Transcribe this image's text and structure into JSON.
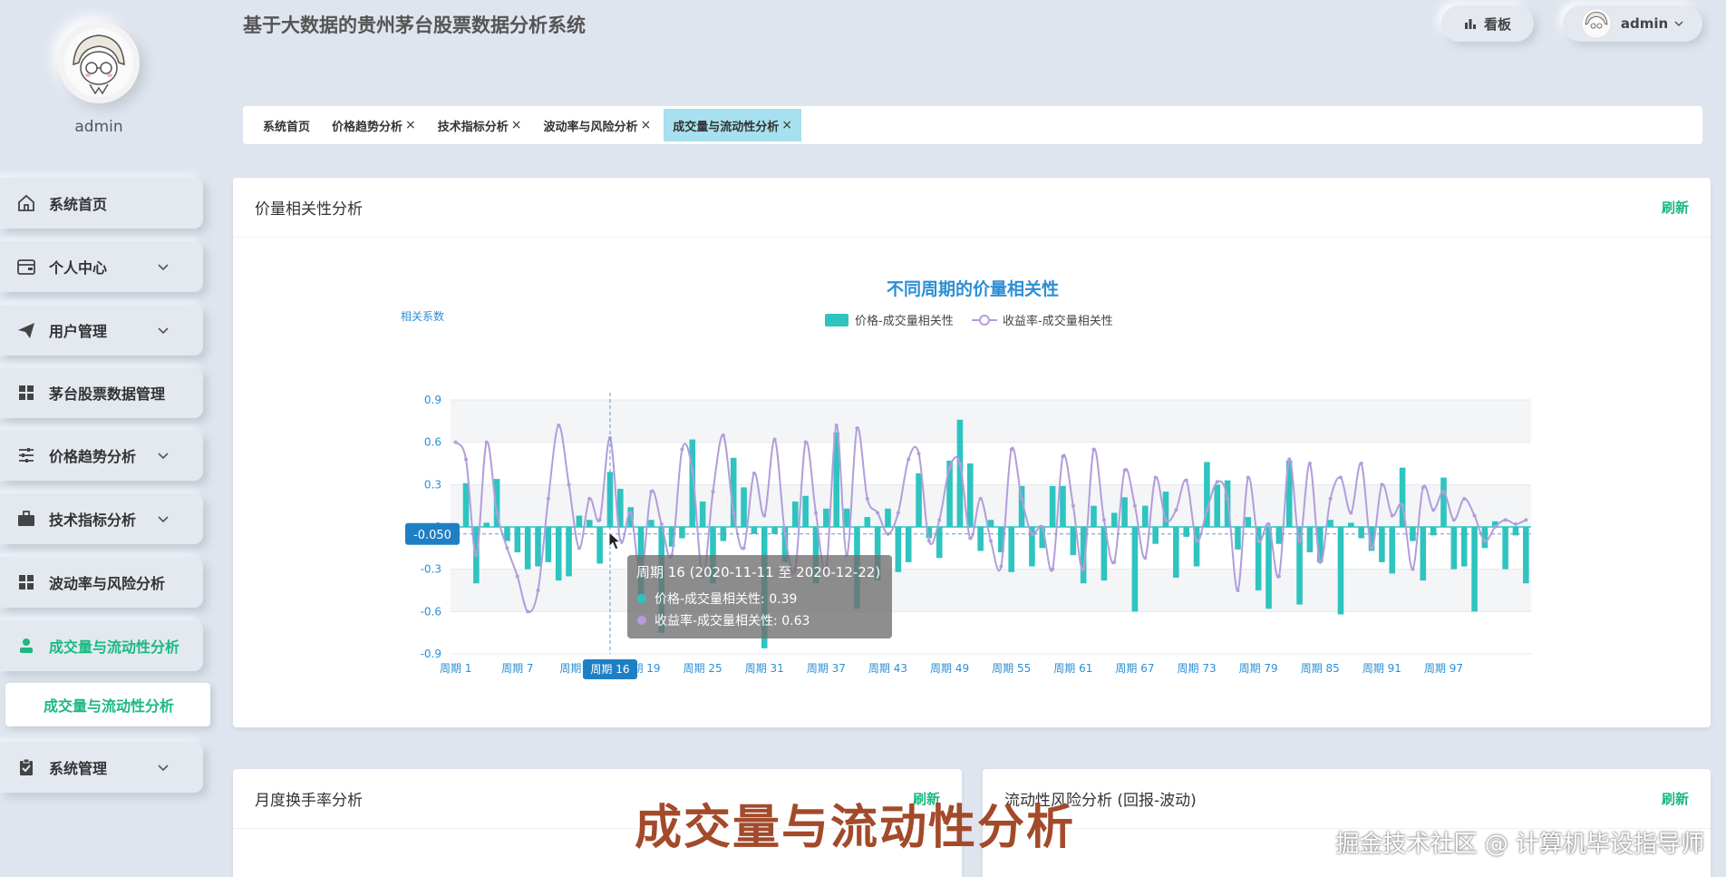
{
  "app": {
    "title": "基于大数据的贵州茅台股票数据分析系统"
  },
  "sidebar": {
    "username": "admin",
    "items": [
      {
        "label": "系统首页",
        "icon": "home-icon",
        "expandable": false
      },
      {
        "label": "个人中心",
        "icon": "wallet-icon",
        "expandable": true
      },
      {
        "label": "用户管理",
        "icon": "send-icon",
        "expandable": true
      },
      {
        "label": "茅台股票数据管理",
        "icon": "grid-icon",
        "expandable": false
      },
      {
        "label": "价格趋势分析",
        "icon": "sliders-icon",
        "expandable": true
      },
      {
        "label": "技术指标分析",
        "icon": "briefcase-icon",
        "expandable": true
      },
      {
        "label": "波动率与风险分析",
        "icon": "grid-icon",
        "expandable": false
      },
      {
        "label": "成交量与流动性分析",
        "icon": "user-icon",
        "expandable": false,
        "active": true
      },
      {
        "label": "系统管理",
        "icon": "clipboard-icon",
        "expandable": true
      }
    ],
    "sub_item": "成交量与流动性分析"
  },
  "topbar": {
    "board_label": "看板",
    "user_label": "admin"
  },
  "tabs": [
    {
      "label": "系统首页",
      "closable": false
    },
    {
      "label": "价格趋势分析",
      "closable": true
    },
    {
      "label": "技术指标分析",
      "closable": true
    },
    {
      "label": "波动率与风险分析",
      "closable": true
    },
    {
      "label": "成交量与流动性分析",
      "closable": true,
      "active": true
    }
  ],
  "main_card": {
    "title": "价量相关性分析",
    "refresh": "刷新"
  },
  "bottom_left_card": {
    "title": "月度换手率分析",
    "refresh": "刷新"
  },
  "bottom_right_card": {
    "title": "流动性风险分析 (回报-波动)",
    "refresh": "刷新"
  },
  "caption": "成交量与流动性分析",
  "watermark": "掘金技术社区 @ 计算机毕设指导师",
  "colors": {
    "accent": "#19b97f",
    "bar": "#2ec4c0",
    "line": "#b39ddb",
    "title": "#2b8fd6"
  },
  "chart_data": {
    "type": "bar",
    "title": "不同周期的价量相关性",
    "ylabel": "相关系数",
    "ylim": [
      -0.9,
      0.9
    ],
    "yticks": [
      "0.9",
      "0.6",
      "0.3",
      "0",
      "-0.3",
      "-0.6",
      "-0.9"
    ],
    "xtick_labels": [
      "周期 1",
      "周期 7",
      "周期 13",
      "周期 19",
      "周期 25",
      "周期 31",
      "周期 37",
      "周期 43",
      "周期 49",
      "周期 55",
      "周期 61",
      "周期 67",
      "周期 73",
      "周期 79",
      "周期 85",
      "周期 91",
      "周期 97"
    ],
    "series": [
      {
        "name": "价格-成交量相关性",
        "type": "bar",
        "values": [
          -0.05,
          0.31,
          -0.4,
          0.03,
          0.34,
          -0.1,
          -0.18,
          -0.3,
          -0.28,
          -0.25,
          -0.38,
          -0.35,
          0.08,
          0.05,
          -0.26,
          0.39,
          0.27,
          0.14,
          -0.5,
          0.05,
          -0.75,
          -0.14,
          -0.08,
          0.62,
          0.18,
          -0.4,
          -0.1,
          0.49,
          0.28,
          -0.05,
          -0.86,
          -0.05,
          -0.25,
          0.18,
          0.22,
          -0.4,
          0.13,
          0.67,
          0.13,
          -0.58,
          0.07,
          -0.38,
          0.13,
          -0.32,
          -0.25,
          0.38,
          -0.08,
          -0.22,
          0.47,
          0.76,
          0.45,
          -0.17,
          0.05,
          -0.18,
          -0.32,
          0.29,
          -0.28,
          -0.15,
          0.29,
          0.29,
          -0.2,
          -0.4,
          0.15,
          -0.38,
          0.1,
          0.21,
          -0.6,
          0.15,
          -0.12,
          0.25,
          -0.36,
          -0.07,
          -0.28,
          0.46,
          0.3,
          0.33,
          -0.16,
          0.07,
          -0.45,
          -0.58,
          -0.12,
          0.47,
          -0.55,
          -0.18,
          -0.25,
          0.05,
          -0.62,
          0.03,
          -0.08,
          -0.17,
          -0.25,
          -0.33,
          0.42,
          -0.1,
          -0.38,
          -0.06,
          0.35,
          -0.3,
          -0.28,
          -0.6,
          -0.15,
          0.04,
          -0.3,
          -0.06,
          -0.4
        ]
      },
      {
        "name": "收益率-成交量相关性",
        "type": "line",
        "values": [
          0.6,
          0.48,
          -0.2,
          0.6,
          0.1,
          -0.15,
          -0.35,
          -0.6,
          -0.45,
          0.2,
          0.72,
          0.3,
          -0.15,
          0.2,
          0.05,
          0.63,
          -0.1,
          0.1,
          -0.35,
          0.25,
          0.02,
          -0.2,
          0.55,
          0.4,
          -0.35,
          0.25,
          0.65,
          0.1,
          -0.15,
          0.38,
          0.08,
          0.62,
          -0.05,
          -0.3,
          0.6,
          0.1,
          -0.3,
          0.72,
          -0.2,
          0.7,
          0.2,
          0.1,
          -0.05,
          0.1,
          0.48,
          0.52,
          -0.1,
          0.05,
          0.42,
          0.45,
          -0.08,
          0.2,
          -0.1,
          -0.28,
          0.55,
          0.2,
          -0.05,
          0.0,
          -0.3,
          0.5,
          0.15,
          -0.3,
          0.55,
          0.05,
          -0.25,
          0.4,
          0.15,
          -0.22,
          0.35,
          0.05,
          0.12,
          0.33,
          -0.1,
          0.12,
          0.32,
          0.2,
          -0.45,
          0.35,
          -0.1,
          0.02,
          -0.35,
          0.48,
          -0.1,
          0.45,
          -0.25,
          0.2,
          0.35,
          0.1,
          0.45,
          -0.15,
          0.3,
          0.08,
          0.15,
          -0.3,
          0.28,
          0.12,
          0.25,
          0.05,
          0.2,
          0.08,
          -0.1,
          0.0,
          0.05,
          0.02,
          0.05
        ]
      }
    ],
    "tooltip": {
      "title": "周期 16 (2020-11-11 至 2020-12-22)",
      "rows": [
        "价格-成交量相关性: 0.39",
        "收益率-成交量相关性: 0.63"
      ]
    },
    "crosshair": {
      "x_label": "周期 16",
      "y_label": "-0.050"
    }
  }
}
